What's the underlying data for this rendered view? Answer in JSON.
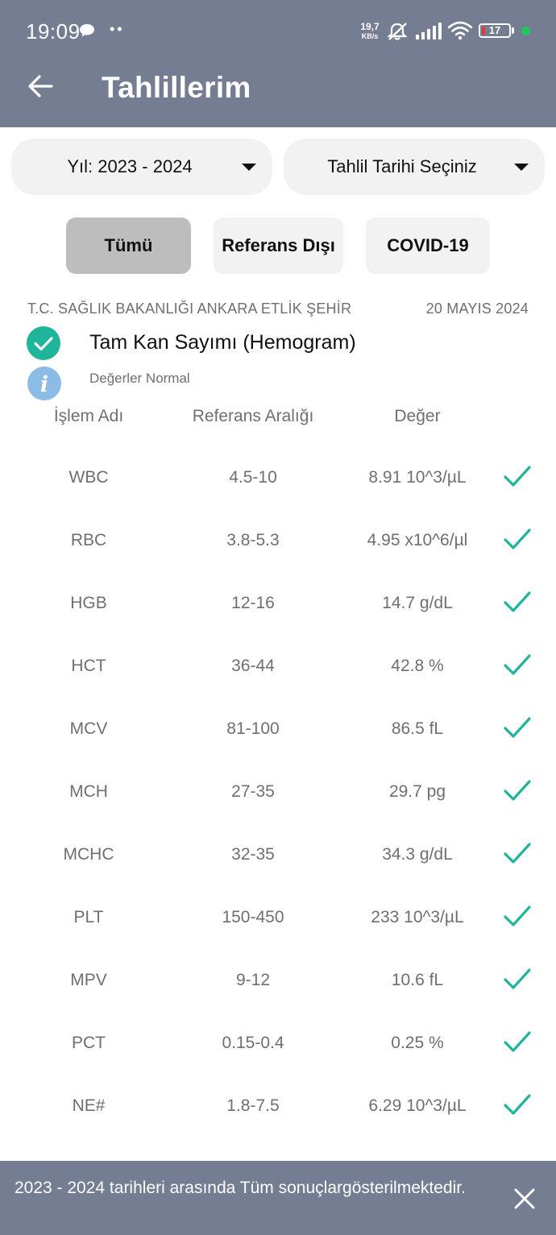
{
  "status_bar": {
    "time": "19:09",
    "dots": "••",
    "net_speed_value": "19,7",
    "net_speed_unit": "KB/s",
    "battery_level": "17",
    "icons": [
      "chat-bubble-icon",
      "mute-icon",
      "signal-icon",
      "wifi-icon",
      "battery-icon"
    ]
  },
  "app_bar": {
    "title": "Tahlillerim",
    "back_icon": "arrow-left-icon"
  },
  "filters": {
    "year_dropdown_label": "Yıl: 2023 - 2024",
    "date_dropdown_label": "Tahlil Tarihi Seçiniz",
    "chips": [
      {
        "label": "Tümü",
        "selected": true
      },
      {
        "label": "Referans Dışı",
        "selected": false
      },
      {
        "label": "COVID-19",
        "selected": false
      }
    ]
  },
  "result": {
    "institution": "T.C. SAĞLIK BAKANLIĞI ANKARA ETLİK ŞEHİR",
    "date": "20 MAYIS 2024",
    "test_name": "Tam Kan Sayımı (Hemogram)",
    "status": "Değerler Normal",
    "headers": {
      "name": "İşlem Adı",
      "reference": "Referans Aralığı",
      "value": "Değer"
    },
    "rows": [
      {
        "name": "WBC",
        "reference": "4.5-10",
        "value": "8.91 10^3/µL",
        "normal": true
      },
      {
        "name": "RBC",
        "reference": "3.8-5.3",
        "value": "4.95 x10^6/µl",
        "normal": true
      },
      {
        "name": "HGB",
        "reference": "12-16",
        "value": "14.7 g/dL",
        "normal": true
      },
      {
        "name": "HCT",
        "reference": "36-44",
        "value": "42.8 %",
        "normal": true
      },
      {
        "name": "MCV",
        "reference": "81-100",
        "value": "86.5 fL",
        "normal": true
      },
      {
        "name": "MCH",
        "reference": "27-35",
        "value": "29.7 pg",
        "normal": true
      },
      {
        "name": "MCHC",
        "reference": "32-35",
        "value": "34.3 g/dL",
        "normal": true
      },
      {
        "name": "PLT",
        "reference": "150-450",
        "value": "233 10^3/µL",
        "normal": true
      },
      {
        "name": "MPV",
        "reference": "9-12",
        "value": "10.6 fL",
        "normal": true
      },
      {
        "name": "PCT",
        "reference": "0.15-0.4",
        "value": "0.25 %",
        "normal": true
      },
      {
        "name": "NE#",
        "reference": "1.8-7.5",
        "value": "6.29 10^3/µL",
        "normal": true
      }
    ]
  },
  "snackbar": {
    "message": "2023 - 2024 tarihleri arasında Tüm sonuçlargösterilmektedir.",
    "close_icon": "close-icon"
  },
  "colors": {
    "primary": "#757d93",
    "success": "#1fb59a",
    "info": "#8cbce6",
    "chip_selected": "#bdbdbd",
    "surface": "#f2f2f2",
    "status_dot": "#22c55e"
  }
}
